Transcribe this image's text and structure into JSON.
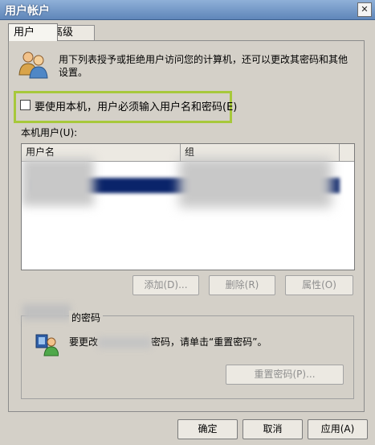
{
  "window": {
    "title": "用户帐户",
    "close_glyph": "✕"
  },
  "tabs": [
    {
      "label": "用户",
      "active": true
    },
    {
      "label": "高级",
      "active": false
    }
  ],
  "intro": {
    "icon": "users-icon",
    "text": "用下列表授予或拒绝用户访问您的计算机，还可以更改其密码和其他设置。"
  },
  "must_logon": {
    "label": "要使用本机，用户必须输入用户名和密码(E)",
    "checked": false,
    "highlight_color": "#a7c83b"
  },
  "local_users": {
    "label": "本机用户(U):",
    "columns": [
      "用户名",
      "组"
    ],
    "selected_row_color": "#0a246a"
  },
  "list_buttons": {
    "add": "添加(D)...",
    "remove": "删除(R)",
    "properties": "属性(O)"
  },
  "password_group": {
    "title_visible": "的密码",
    "icon": "password-user-icon",
    "text_prefix": "要更改",
    "text_suffix": "密码，请单击“重置密码”。",
    "reset_button": "重置密码(P)..."
  },
  "footer": {
    "ok": "确定",
    "cancel": "取消",
    "apply": "应用(A)"
  }
}
